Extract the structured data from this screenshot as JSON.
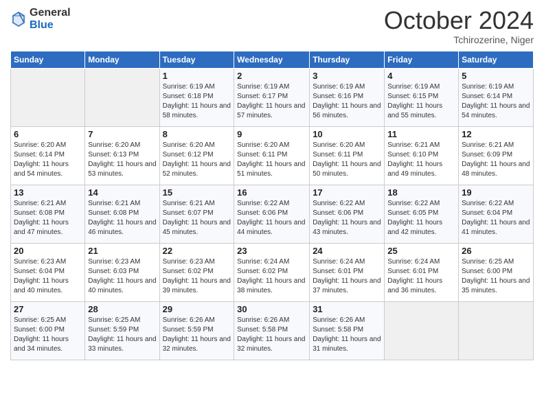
{
  "logo": {
    "general": "General",
    "blue": "Blue"
  },
  "header": {
    "month": "October 2024",
    "location": "Tchirozerine, Niger"
  },
  "weekdays": [
    "Sunday",
    "Monday",
    "Tuesday",
    "Wednesday",
    "Thursday",
    "Friday",
    "Saturday"
  ],
  "weeks": [
    [
      {
        "day": "",
        "sunrise": "",
        "sunset": "",
        "daylight": ""
      },
      {
        "day": "",
        "sunrise": "",
        "sunset": "",
        "daylight": ""
      },
      {
        "day": "1",
        "sunrise": "Sunrise: 6:19 AM",
        "sunset": "Sunset: 6:18 PM",
        "daylight": "Daylight: 11 hours and 58 minutes."
      },
      {
        "day": "2",
        "sunrise": "Sunrise: 6:19 AM",
        "sunset": "Sunset: 6:17 PM",
        "daylight": "Daylight: 11 hours and 57 minutes."
      },
      {
        "day": "3",
        "sunrise": "Sunrise: 6:19 AM",
        "sunset": "Sunset: 6:16 PM",
        "daylight": "Daylight: 11 hours and 56 minutes."
      },
      {
        "day": "4",
        "sunrise": "Sunrise: 6:19 AM",
        "sunset": "Sunset: 6:15 PM",
        "daylight": "Daylight: 11 hours and 55 minutes."
      },
      {
        "day": "5",
        "sunrise": "Sunrise: 6:19 AM",
        "sunset": "Sunset: 6:14 PM",
        "daylight": "Daylight: 11 hours and 54 minutes."
      }
    ],
    [
      {
        "day": "6",
        "sunrise": "Sunrise: 6:20 AM",
        "sunset": "Sunset: 6:14 PM",
        "daylight": "Daylight: 11 hours and 54 minutes."
      },
      {
        "day": "7",
        "sunrise": "Sunrise: 6:20 AM",
        "sunset": "Sunset: 6:13 PM",
        "daylight": "Daylight: 11 hours and 53 minutes."
      },
      {
        "day": "8",
        "sunrise": "Sunrise: 6:20 AM",
        "sunset": "Sunset: 6:12 PM",
        "daylight": "Daylight: 11 hours and 52 minutes."
      },
      {
        "day": "9",
        "sunrise": "Sunrise: 6:20 AM",
        "sunset": "Sunset: 6:11 PM",
        "daylight": "Daylight: 11 hours and 51 minutes."
      },
      {
        "day": "10",
        "sunrise": "Sunrise: 6:20 AM",
        "sunset": "Sunset: 6:11 PM",
        "daylight": "Daylight: 11 hours and 50 minutes."
      },
      {
        "day": "11",
        "sunrise": "Sunrise: 6:21 AM",
        "sunset": "Sunset: 6:10 PM",
        "daylight": "Daylight: 11 hours and 49 minutes."
      },
      {
        "day": "12",
        "sunrise": "Sunrise: 6:21 AM",
        "sunset": "Sunset: 6:09 PM",
        "daylight": "Daylight: 11 hours and 48 minutes."
      }
    ],
    [
      {
        "day": "13",
        "sunrise": "Sunrise: 6:21 AM",
        "sunset": "Sunset: 6:08 PM",
        "daylight": "Daylight: 11 hours and 47 minutes."
      },
      {
        "day": "14",
        "sunrise": "Sunrise: 6:21 AM",
        "sunset": "Sunset: 6:08 PM",
        "daylight": "Daylight: 11 hours and 46 minutes."
      },
      {
        "day": "15",
        "sunrise": "Sunrise: 6:21 AM",
        "sunset": "Sunset: 6:07 PM",
        "daylight": "Daylight: 11 hours and 45 minutes."
      },
      {
        "day": "16",
        "sunrise": "Sunrise: 6:22 AM",
        "sunset": "Sunset: 6:06 PM",
        "daylight": "Daylight: 11 hours and 44 minutes."
      },
      {
        "day": "17",
        "sunrise": "Sunrise: 6:22 AM",
        "sunset": "Sunset: 6:06 PM",
        "daylight": "Daylight: 11 hours and 43 minutes."
      },
      {
        "day": "18",
        "sunrise": "Sunrise: 6:22 AM",
        "sunset": "Sunset: 6:05 PM",
        "daylight": "Daylight: 11 hours and 42 minutes."
      },
      {
        "day": "19",
        "sunrise": "Sunrise: 6:22 AM",
        "sunset": "Sunset: 6:04 PM",
        "daylight": "Daylight: 11 hours and 41 minutes."
      }
    ],
    [
      {
        "day": "20",
        "sunrise": "Sunrise: 6:23 AM",
        "sunset": "Sunset: 6:04 PM",
        "daylight": "Daylight: 11 hours and 40 minutes."
      },
      {
        "day": "21",
        "sunrise": "Sunrise: 6:23 AM",
        "sunset": "Sunset: 6:03 PM",
        "daylight": "Daylight: 11 hours and 40 minutes."
      },
      {
        "day": "22",
        "sunrise": "Sunrise: 6:23 AM",
        "sunset": "Sunset: 6:02 PM",
        "daylight": "Daylight: 11 hours and 39 minutes."
      },
      {
        "day": "23",
        "sunrise": "Sunrise: 6:24 AM",
        "sunset": "Sunset: 6:02 PM",
        "daylight": "Daylight: 11 hours and 38 minutes."
      },
      {
        "day": "24",
        "sunrise": "Sunrise: 6:24 AM",
        "sunset": "Sunset: 6:01 PM",
        "daylight": "Daylight: 11 hours and 37 minutes."
      },
      {
        "day": "25",
        "sunrise": "Sunrise: 6:24 AM",
        "sunset": "Sunset: 6:01 PM",
        "daylight": "Daylight: 11 hours and 36 minutes."
      },
      {
        "day": "26",
        "sunrise": "Sunrise: 6:25 AM",
        "sunset": "Sunset: 6:00 PM",
        "daylight": "Daylight: 11 hours and 35 minutes."
      }
    ],
    [
      {
        "day": "27",
        "sunrise": "Sunrise: 6:25 AM",
        "sunset": "Sunset: 6:00 PM",
        "daylight": "Daylight: 11 hours and 34 minutes."
      },
      {
        "day": "28",
        "sunrise": "Sunrise: 6:25 AM",
        "sunset": "Sunset: 5:59 PM",
        "daylight": "Daylight: 11 hours and 33 minutes."
      },
      {
        "day": "29",
        "sunrise": "Sunrise: 6:26 AM",
        "sunset": "Sunset: 5:59 PM",
        "daylight": "Daylight: 11 hours and 32 minutes."
      },
      {
        "day": "30",
        "sunrise": "Sunrise: 6:26 AM",
        "sunset": "Sunset: 5:58 PM",
        "daylight": "Daylight: 11 hours and 32 minutes."
      },
      {
        "day": "31",
        "sunrise": "Sunrise: 6:26 AM",
        "sunset": "Sunset: 5:58 PM",
        "daylight": "Daylight: 11 hours and 31 minutes."
      },
      {
        "day": "",
        "sunrise": "",
        "sunset": "",
        "daylight": ""
      },
      {
        "day": "",
        "sunrise": "",
        "sunset": "",
        "daylight": ""
      }
    ]
  ]
}
